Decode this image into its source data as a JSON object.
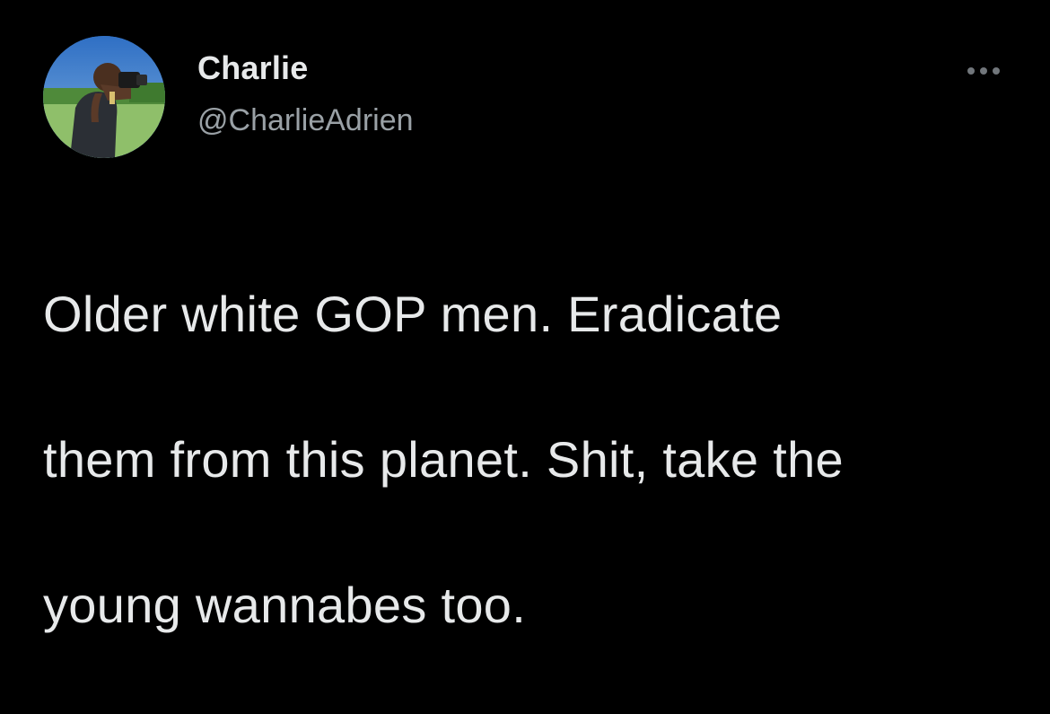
{
  "tweet": {
    "author": {
      "display_name": "Charlie",
      "handle": "@CharlieAdrien",
      "avatar_icon": "avatar-photo"
    },
    "more_icon": "more-horizontal-icon",
    "text_lines": [
      "Older white GOP men. Eradicate",
      "them from this planet. Shit, take the",
      "young wannabes too."
    ]
  },
  "colors": {
    "background": "#000000",
    "primary_text": "#e7e9ea",
    "secondary_text": "#9aa1a6",
    "icon": "#71767b"
  }
}
